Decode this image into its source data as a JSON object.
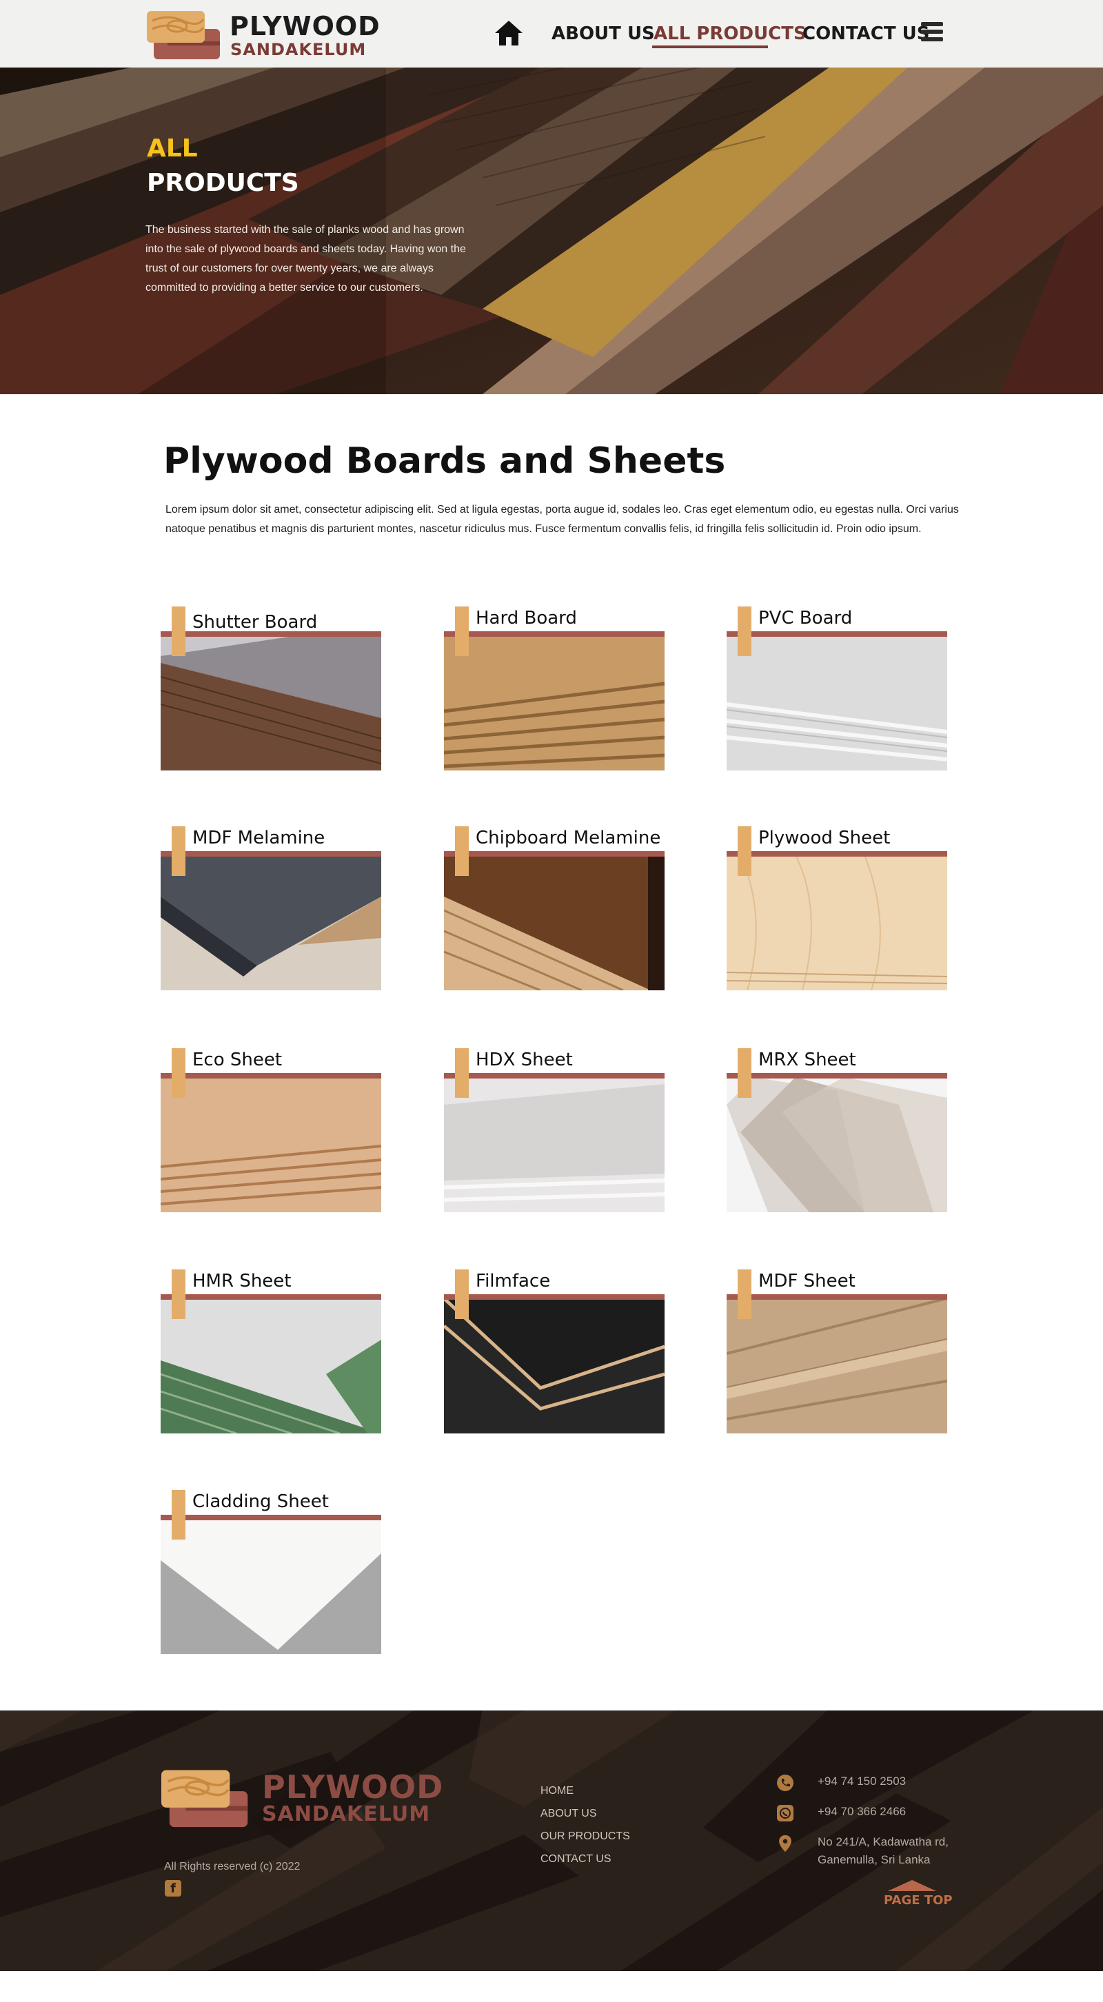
{
  "header": {
    "logo_line1": "PLYWOOD",
    "logo_line2": "SANDAKELUM",
    "nav": {
      "home_icon": "home-icon",
      "about": "ABOUT US",
      "products": "ALL PRODUCTS",
      "contact": "CONTACT US",
      "menu_icon": "hamburger-menu-icon"
    }
  },
  "hero": {
    "title_line1": "ALL",
    "title_line2": "PRODUCTS",
    "text": "The business started with the sale of planks wood and has grown into the sale of plywood boards and sheets today. Having won the trust of our customers for over twenty years, we are always committed to providing a better service to our customers."
  },
  "main": {
    "title": "Plywood Boards and Sheets",
    "description": "Lorem ipsum dolor sit amet, consectetur adipiscing elit. Sed at ligula egestas, porta augue id, sodales leo. Cras eget elementum odio, eu egestas nulla. Orci varius natoque penatibus et magnis dis parturient montes, nascetur ridiculus mus. Fusce fermentum convallis felis, id fringilla felis sollicitudin id. Proin odio ipsum."
  },
  "products": [
    {
      "label": "Shutter Board"
    },
    {
      "label": "Hard Board"
    },
    {
      "label": "PVC Board"
    },
    {
      "label": "MDF Melamine"
    },
    {
      "label": "Chipboard Melamine"
    },
    {
      "label": "Plywood Sheet"
    },
    {
      "label": "Eco Sheet"
    },
    {
      "label": "HDX Sheet"
    },
    {
      "label": "MRX Sheet"
    },
    {
      "label": "HMR Sheet"
    },
    {
      "label": "Filmface"
    },
    {
      "label": "MDF Sheet"
    },
    {
      "label": "Cladding Sheet"
    }
  ],
  "footer": {
    "logo_line1": "PLYWOOD",
    "logo_line2": "SANDAKELUM",
    "rights": "All Rights reserved (c) 2022",
    "facebook_icon": "facebook-icon",
    "links": [
      "HOME",
      "ABOUT US",
      "OUR PRODUCTS",
      "CONTACT US"
    ],
    "phone": "+94 74 150 2503",
    "whatsapp": "+94 70 366 2466",
    "address_line1": "No 241/A, Kadawatha rd,",
    "address_line2": "Ganemulla, Sri Lanka",
    "page_top": "PAGE TOP"
  },
  "colors": {
    "brand_brown": "#7a3b35",
    "card_bar": "#a65a4f",
    "card_tag": "#e3ad69",
    "hero_accent": "#f6c21b",
    "footer_bg": "#231b16"
  }
}
